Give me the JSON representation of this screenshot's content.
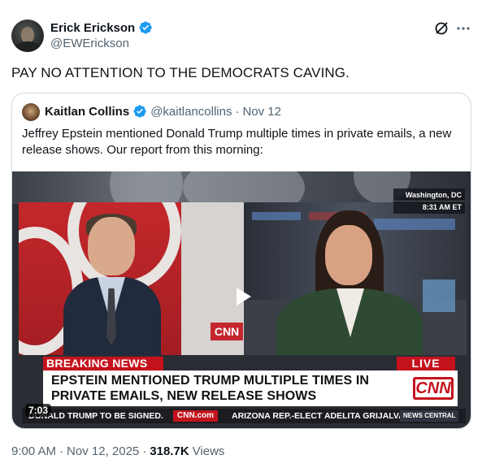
{
  "author": {
    "name": "Erick Erickson",
    "handle": "@EWErickson"
  },
  "tweet": {
    "text": "PAY NO ATTENTION TO THE DEMOCRATS CAVING."
  },
  "quoted": {
    "name": "Kaitlan Collins",
    "handle": "@kaitlancollins",
    "separator": "·",
    "date": "Nov 12",
    "text": "Jeffrey Epstein mentioned Donald Trump multiple times in private emails, a new release shows. Our report from this morning:"
  },
  "video": {
    "location": "Washington, DC",
    "time": "8:31 AM ET",
    "breaking": "BREAKING NEWS",
    "live": "LIVE",
    "headline": "EPSTEIN MENTIONED TRUMP MULTIPLE TIMES IN PRIVATE EMAILS, NEW RELEASE SHOWS",
    "cnn_logo": "CNN",
    "ticker_left": "DONALD TRUMP TO BE SIGNED.",
    "ticker_brand": "CNN.com",
    "ticker_right": "ARIZONA REP.-ELECT ADELITA GRIJALVA",
    "ticker_tag": "NEWS CENTRAL",
    "duration": "7:03"
  },
  "footer": {
    "time": "9:00 AM",
    "separator1": "·",
    "date": "Nov 12, 2025",
    "separator2": "·",
    "views_count": "318.7K",
    "views_label": "Views"
  },
  "icons": {
    "verified": "verified-badge-icon",
    "grok": "grok-icon",
    "more": "more-icon",
    "play": "play-icon"
  },
  "colors": {
    "verified_blue": "#1d9bf0",
    "text_primary": "#0f1419",
    "text_secondary": "#536471",
    "cnn_red": "#c4131d"
  }
}
